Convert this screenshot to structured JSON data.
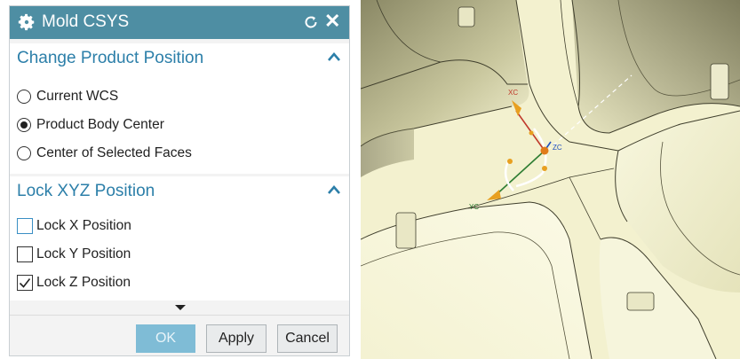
{
  "dialog": {
    "title": "Mold CSYS",
    "icons": {
      "settings": "gear-icon",
      "reset": "reset-icon",
      "close": "close-icon"
    },
    "close_glyph": "✕"
  },
  "product_position": {
    "header": "Change Product Position",
    "options": [
      {
        "label": "Current WCS",
        "selected": false
      },
      {
        "label": "Product Body Center",
        "selected": true
      },
      {
        "label": "Center of Selected Faces",
        "selected": false
      }
    ]
  },
  "lock_position": {
    "header": "Lock XYZ Position",
    "options": [
      {
        "label": "Lock X Position",
        "checked": false
      },
      {
        "label": "Lock Y Position",
        "checked": false
      },
      {
        "label": "Lock Z Position",
        "checked": true
      }
    ]
  },
  "buttons": {
    "ok": "OK",
    "apply": "Apply",
    "cancel": "Cancel"
  },
  "viewport": {
    "axis_labels": {
      "x": "XC",
      "y": "YC",
      "z": "ZC"
    },
    "colors": {
      "part_face": "#f2f0cc",
      "part_shadow": "#7a7858",
      "x_axis": "#c0392b",
      "y_axis": "#2e7d32",
      "z_axis": "#1f4fbf",
      "handle": "#e8a020"
    }
  },
  "colors": {
    "titlebar": "#4e8ea3",
    "header_text": "#2c7fa9",
    "ok_button": "#7fbcd6"
  }
}
